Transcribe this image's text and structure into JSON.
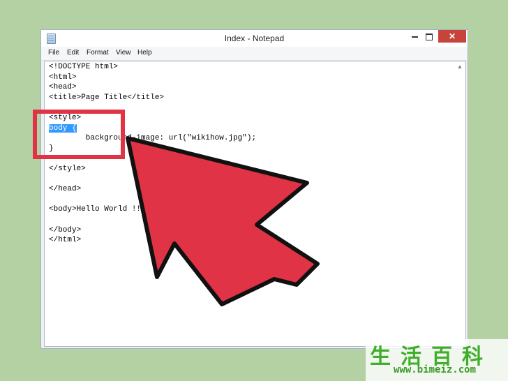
{
  "window": {
    "title": "Index - Notepad",
    "close_glyph": "✕"
  },
  "menu": [
    {
      "label": "File"
    },
    {
      "label": "Edit"
    },
    {
      "label": "Format"
    },
    {
      "label": "View"
    },
    {
      "label": "Help"
    }
  ],
  "editor": {
    "lines": [
      "<!DOCTYPE html>",
      "<html>",
      "<head>",
      "<title>Page Title</title>",
      "",
      "<style>",
      "body {",
      "        background-image: url(\"wikihow.jpg\");",
      "}",
      "",
      "</style>",
      "",
      "</head>",
      "",
      "<body>Hello World !!",
      "",
      "</body>",
      "</html>"
    ],
    "selected_text": "body {"
  },
  "colors": {
    "background": "#b3d1a2",
    "annotation_red": "#e03345",
    "selection_blue": "#3399ff",
    "close_button": "#c7443a"
  },
  "watermark": {
    "chars": "生活百科",
    "url": "www.bimeiz.com"
  }
}
